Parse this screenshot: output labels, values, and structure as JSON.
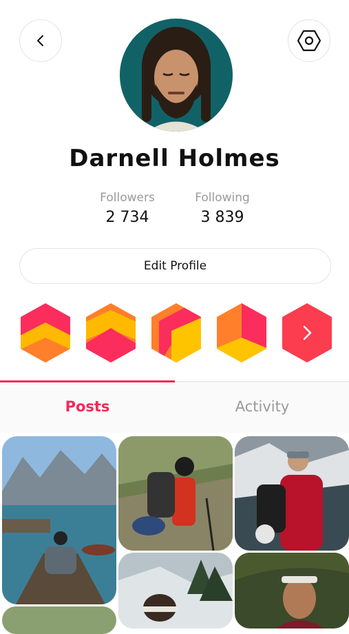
{
  "profile": {
    "name": "Darnell Holmes",
    "followers_label": "Followers",
    "followers_count": "2 734",
    "following_label": "Following",
    "following_count": "3 839",
    "edit_label": "Edit Profile"
  },
  "tabs": [
    {
      "label": "Posts",
      "active": true
    },
    {
      "label": "Activity",
      "active": false
    }
  ],
  "badges": [
    {
      "name": "badge-1",
      "colors": [
        "#fb2d5c",
        "#ffb900",
        "#ff7f2a"
      ]
    },
    {
      "name": "badge-2",
      "colors": [
        "#ff7f2a",
        "#ffb900",
        "#fb2d5c"
      ]
    },
    {
      "name": "badge-3",
      "colors": [
        "#ff7f2a",
        "#fb2d5c",
        "#ffc400"
      ]
    },
    {
      "name": "badge-4",
      "colors": [
        "#ff7f2a",
        "#fb2d5c",
        "#ffc400"
      ]
    },
    {
      "name": "badge-more",
      "colors": [
        "#fb3d4f"
      ]
    }
  ],
  "colors": {
    "accent": "#f02a58",
    "muted": "#9a9a9a",
    "border": "#e3e3e3"
  },
  "icons": {
    "back": "chevron-left-icon",
    "settings": "hexagon-gear-icon",
    "more": "chevron-right-icon"
  }
}
